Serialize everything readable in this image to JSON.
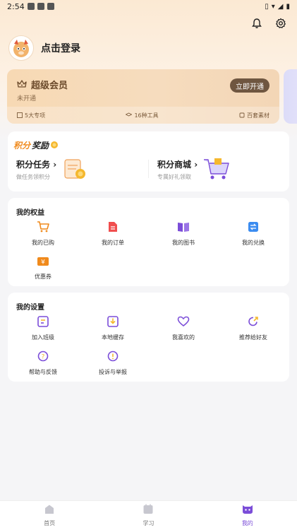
{
  "status_bar": {
    "time": "2:54"
  },
  "header": {
    "icons": [
      "bell-icon",
      "gear-icon"
    ]
  },
  "profile": {
    "login_text": "点击登录"
  },
  "vip": {
    "title": "超级会员",
    "status": "未开通",
    "button": "立即开通",
    "features": [
      "5大专项",
      "16种工具",
      "百套素材"
    ]
  },
  "points": {
    "logo_part1": "积分",
    "logo_part2": "奖励",
    "task_title": "积分任务",
    "task_sub": "做任务领积分",
    "mall_title": "积分商城",
    "mall_sub": "专属好礼领取"
  },
  "rights": {
    "title": "我的权益",
    "items": [
      "我的已购",
      "我的订单",
      "我的图书",
      "我的兑换",
      "优惠券"
    ]
  },
  "settings": {
    "title": "我的设置",
    "items": [
      "加入班级",
      "本地缓存",
      "我喜欢的",
      "推荐给好友",
      "帮助与反馈",
      "投诉与举报"
    ]
  },
  "tabbar": {
    "tabs": [
      "首页",
      "学习",
      "我的"
    ],
    "active": "我的"
  },
  "colors": {
    "accent": "#7b4dd8",
    "orange": "#f08a1c",
    "vip_bg": "#f7d9b4"
  }
}
